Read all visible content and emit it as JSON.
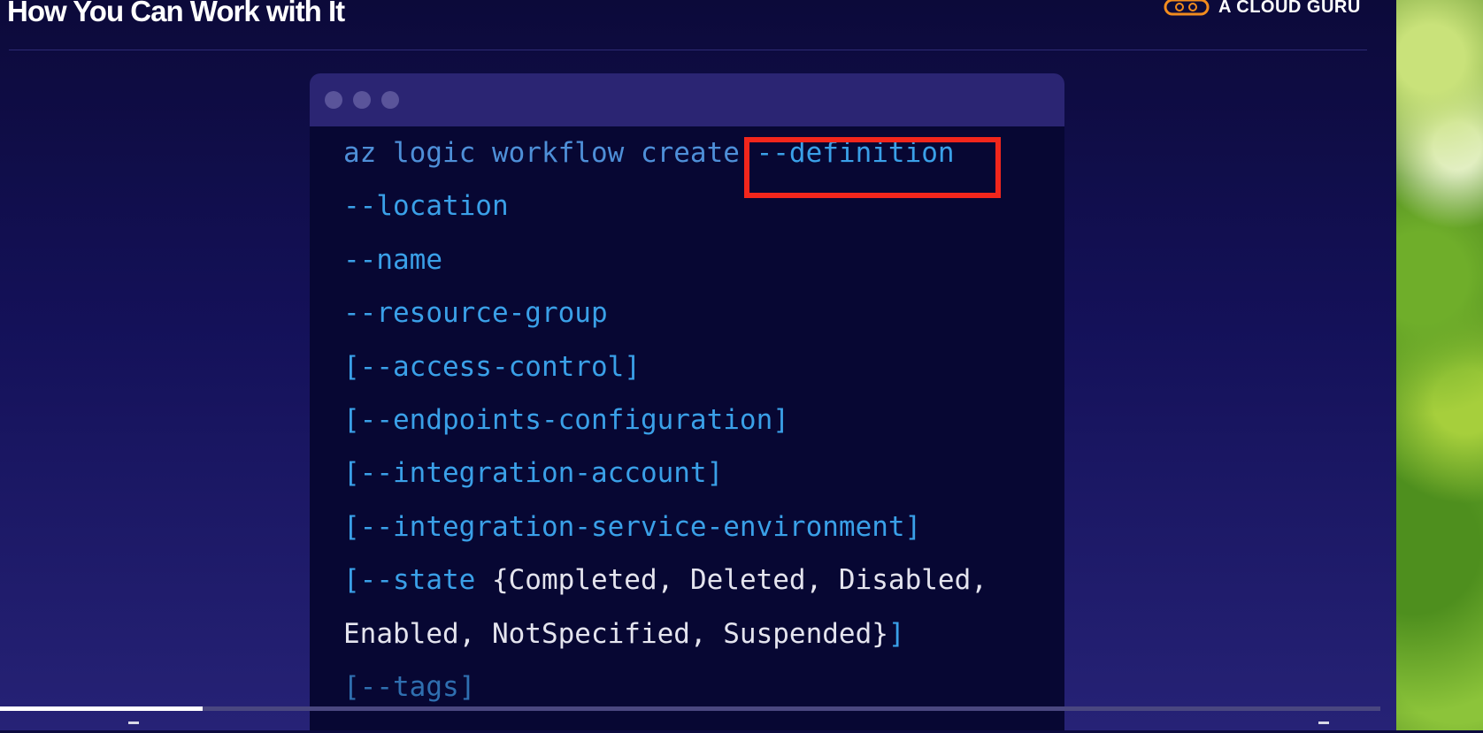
{
  "slide": {
    "title": "How You Can Work with It",
    "brand": "A CLOUD GURU"
  },
  "code": {
    "line1_command": "az logic workflow create ",
    "line1_highlight": "--definition",
    "line2": "--location",
    "line3": "--name",
    "line4": "--resource-group",
    "line5": "[--access-control]",
    "line6": "[--endpoints-configuration]",
    "line7": "[--integration-account]",
    "line8": "[--integration-service-environment]",
    "line9_open": "[--state ",
    "line9_values": "{Completed, Deleted, Disabled,",
    "line10_values": "Enabled, NotSpecified, Suspended}",
    "line10_close": "]",
    "line11": "[--tags]"
  },
  "player": {
    "progress": 0.147
  },
  "colors": {
    "background": "#141159",
    "code_background": "#070733",
    "window_bar": "#2b2573",
    "flag": "#3aa0e8",
    "command": "#4e8fd8",
    "highlight_border": "#f2261c",
    "brand_accent": "#f28c1e"
  }
}
